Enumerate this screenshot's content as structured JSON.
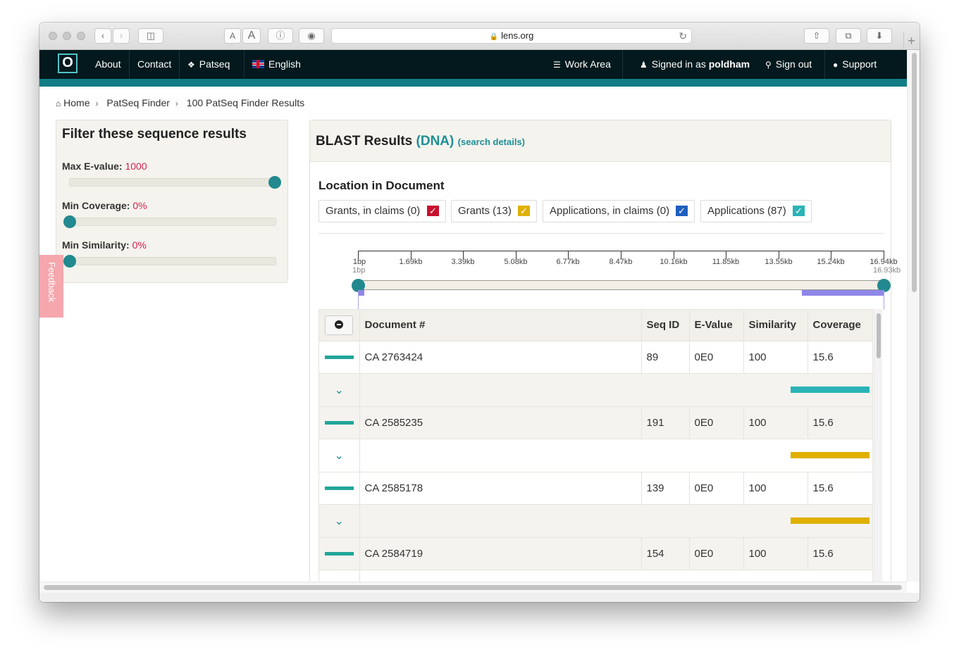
{
  "browser": {
    "url": "lens.org",
    "font_small": "A",
    "font_large": "A"
  },
  "nav": {
    "about": "About",
    "contact": "Contact",
    "patseq": "Patseq",
    "language": "English",
    "work_area": "Work Area",
    "signed_in_prefix": "Signed in as ",
    "username": "poldham",
    "sign_out": "Sign out",
    "support": "Support"
  },
  "breadcrumb": [
    "Home",
    "PatSeq Finder",
    "100 PatSeq Finder Results"
  ],
  "filter": {
    "title": "Filter these sequence results",
    "max_evalue_label": "Max E-value:",
    "max_evalue": "1000",
    "min_coverage_label": "Min Coverage:",
    "min_coverage": "0%",
    "min_similarity_label": "Min Similarity:",
    "min_similarity": "0%"
  },
  "feedback": "Feedback",
  "results": {
    "title": "BLAST Results",
    "type": "(DNA)",
    "details_link": "(search details)",
    "location_title": "Location in Document",
    "categories": [
      {
        "label": "Grants, in claims (0)",
        "color": "#c8102e"
      },
      {
        "label": "Grants (13)",
        "color": "#e0b000"
      },
      {
        "label": "Applications, in claims (0)",
        "color": "#1f5fbf"
      },
      {
        "label": "Applications (87)",
        "color": "#2ab3b6"
      }
    ],
    "ruler_ticks": [
      "1bp",
      "1.69kb",
      "3.39kb",
      "5.08kb",
      "6.77kb",
      "8.47kb",
      "10.16kb",
      "11.85kb",
      "13.55kb",
      "15.24kb",
      "16.94kb"
    ],
    "ruler_start": "1bp",
    "ruler_end": "16.93kb",
    "columns": [
      "Document #",
      "Seq ID",
      "E-Value",
      "Similarity",
      "Coverage"
    ],
    "rows": [
      {
        "doc": "CA 2763424",
        "seq_id": "89",
        "evalue": "0E0",
        "similarity": "100",
        "coverage": "15.6",
        "hit_color": "#2ab3b6"
      },
      {
        "doc": "CA 2585235",
        "seq_id": "191",
        "evalue": "0E0",
        "similarity": "100",
        "coverage": "15.6",
        "hit_color": "#e0b000"
      },
      {
        "doc": "CA 2585178",
        "seq_id": "139",
        "evalue": "0E0",
        "similarity": "100",
        "coverage": "15.6",
        "hit_color": "#e0b000"
      },
      {
        "doc": "CA 2584719",
        "seq_id": "154",
        "evalue": "0E0",
        "similarity": "100",
        "coverage": "15.6",
        "hit_color": "#e0b000"
      }
    ]
  }
}
